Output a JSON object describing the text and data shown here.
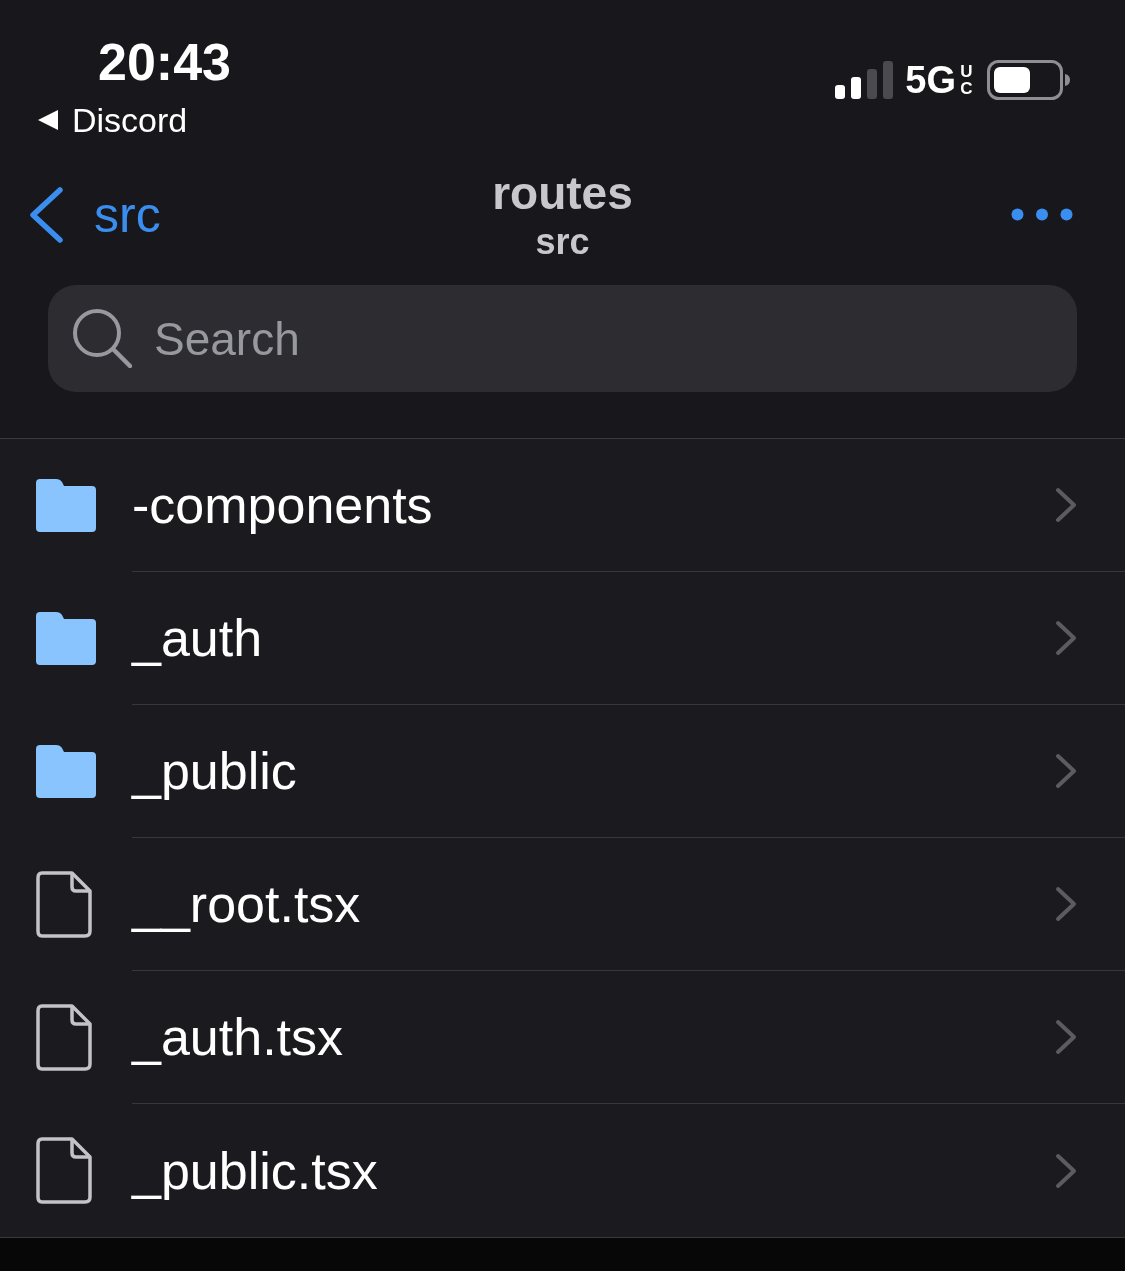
{
  "status_bar": {
    "time": "20:43",
    "back_app": "Discord",
    "network": "5G",
    "network_badge": "UC"
  },
  "nav": {
    "back_label": "src",
    "title": "routes",
    "subtitle": "src"
  },
  "search": {
    "placeholder": "Search"
  },
  "items": [
    {
      "kind": "folder",
      "name": "-components"
    },
    {
      "kind": "folder",
      "name": "_auth"
    },
    {
      "kind": "folder",
      "name": "_public"
    },
    {
      "kind": "file",
      "name": "__root.tsx"
    },
    {
      "kind": "file",
      "name": "_auth.tsx"
    },
    {
      "kind": "file",
      "name": "_public.tsx"
    }
  ]
}
